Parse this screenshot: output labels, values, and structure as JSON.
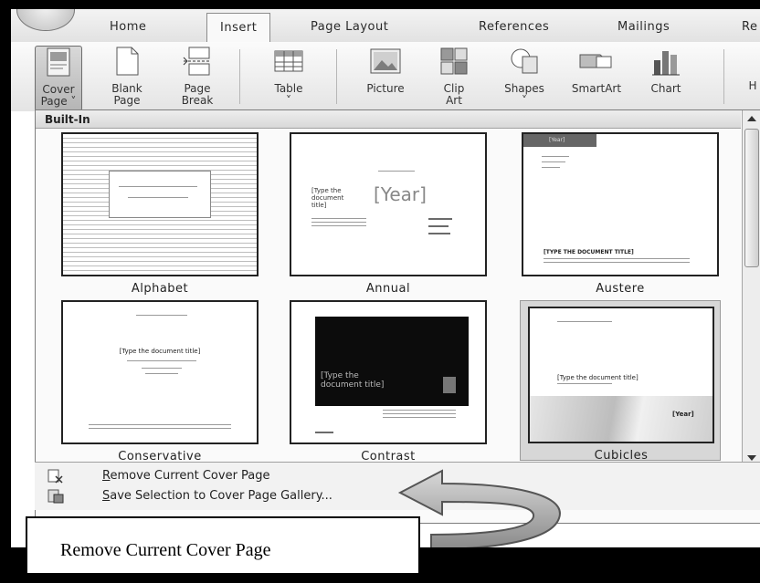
{
  "ribbon": {
    "tabs": [
      {
        "label": "Home",
        "active": false
      },
      {
        "label": "Insert",
        "active": true
      },
      {
        "label": "Page Layout",
        "active": false
      },
      {
        "label": "References",
        "active": false
      },
      {
        "label": "Mailings",
        "active": false
      },
      {
        "label": "Re",
        "active": false
      }
    ],
    "buttons": [
      {
        "label1": "Cover",
        "label2": "Page ˅",
        "icon": "cover-page-icon"
      },
      {
        "label1": "Blank",
        "label2": "Page",
        "icon": "blank-page-icon"
      },
      {
        "label1": "Page",
        "label2": "Break",
        "icon": "page-break-icon"
      },
      {
        "label1": "Table",
        "label2": "˅",
        "icon": "table-icon"
      },
      {
        "label1": "Picture",
        "label2": "",
        "icon": "picture-icon"
      },
      {
        "label1": "Clip",
        "label2": "Art",
        "icon": "clip-art-icon"
      },
      {
        "label1": "Shapes",
        "label2": "˅",
        "icon": "shapes-icon"
      },
      {
        "label1": "SmartArt",
        "label2": "",
        "icon": "smartart-icon"
      },
      {
        "label1": "Chart",
        "label2": "",
        "icon": "chart-icon"
      },
      {
        "label1": "H",
        "label2": "",
        "icon": ""
      }
    ]
  },
  "gallery": {
    "header": "Built-In",
    "items": [
      {
        "name": "Alphabet"
      },
      {
        "name": "Annual",
        "title_ph": "[Type the document title]",
        "year_ph": "[Year]"
      },
      {
        "name": "Austere",
        "title_ph": "[TYPE THE DOCUMENT TITLE]",
        "year_ph": "[Year]"
      },
      {
        "name": "Conservative",
        "title_ph": "[Type the document title]"
      },
      {
        "name": "Contrast",
        "title_ph": "[Type the document title]"
      },
      {
        "name": "Cubicles",
        "title_ph": "[Type the document title]",
        "year_ph": "[Year]"
      }
    ]
  },
  "menu": {
    "remove": {
      "first": "R",
      "rest": "emove Current Cover Page",
      "icon": "remove-cover-icon"
    },
    "save": {
      "first": "S",
      "rest": "ave Selection to Cover Page Gallery...",
      "icon": "save-selection-icon"
    }
  },
  "callout": {
    "text": "Remove Current Cover Page"
  }
}
